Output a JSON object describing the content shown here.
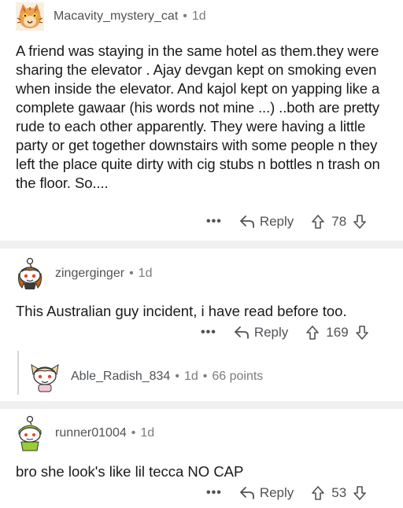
{
  "comments": [
    {
      "username": "Macavity_mystery_cat",
      "age": "1d",
      "body": "A friend  was staying in the same hotel as them.they were sharing the elevator . Ajay devgan kept on smoking even when inside the elevator. And kajol kept on yapping like a complete gawaar (his words not mine ...) ..both are pretty rude to each other apparently. They were having a little party or get together downstairs with some people n they left the place quite dirty with  cig stubs n bottles n trash on the floor. So....",
      "more": "•••",
      "reply_label": "Reply",
      "score": "78"
    },
    {
      "username": "zingerginger",
      "age": "1d",
      "body": "This Australian guy incident, i have read before too.",
      "more": "•••",
      "reply_label": "Reply",
      "score": "169"
    },
    {
      "username": "Able_Radish_834",
      "age": "1d",
      "points": "66 points"
    },
    {
      "username": "runner01004",
      "age": "1d",
      "body": "bro she look's like lil tecca NO CAP",
      "more": "•••",
      "reply_label": "Reply",
      "score": "53"
    }
  ],
  "separator": "•",
  "icons": {
    "reply": "reply-arrow-icon",
    "upvote": "upvote-arrow-icon",
    "downvote": "downvote-arrow-icon",
    "more": "more-options-icon"
  }
}
